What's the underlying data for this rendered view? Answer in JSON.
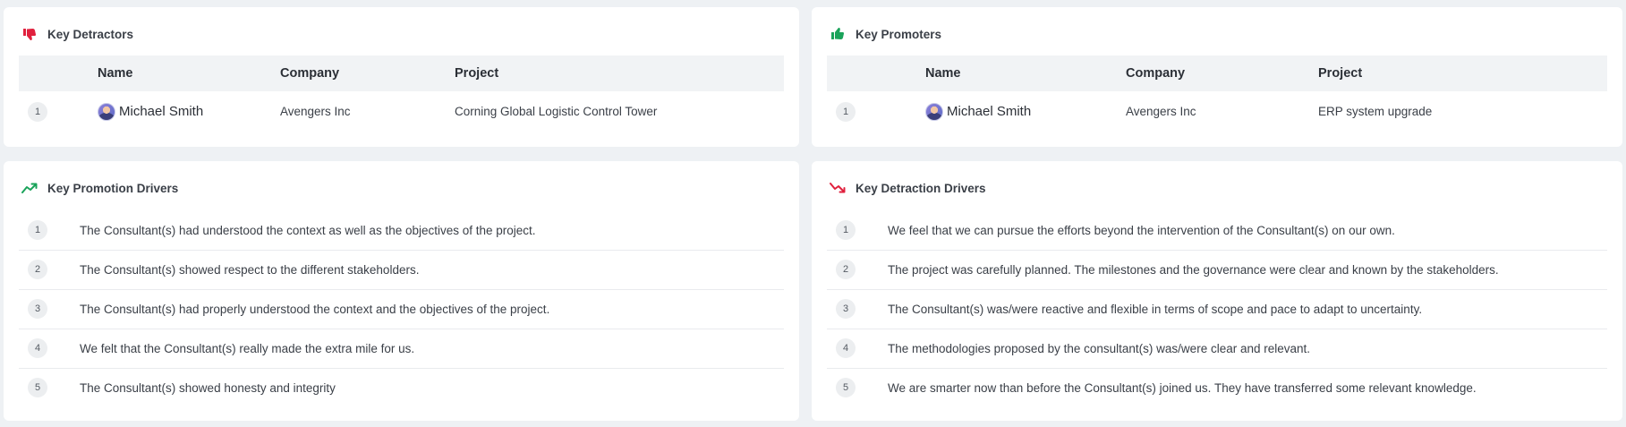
{
  "detractors": {
    "title": "Key Detractors",
    "icon": "thumbs-down-icon",
    "icon_color": "#e0203d",
    "columns": [
      "Name",
      "Company",
      "Project"
    ],
    "rows": [
      {
        "num": "1",
        "name": "Michael Smith",
        "company": "Avengers Inc",
        "project": "Corning Global Logistic Control Tower"
      }
    ]
  },
  "promoters": {
    "title": "Key Promoters",
    "icon": "thumbs-up-icon",
    "icon_color": "#1aa35a",
    "columns": [
      "Name",
      "Company",
      "Project"
    ],
    "rows": [
      {
        "num": "1",
        "name": "Michael Smith",
        "company": "Avengers Inc",
        "project": "ERP system upgrade"
      }
    ]
  },
  "promotion_drivers": {
    "title": "Key Promotion Drivers",
    "icon": "trend-up-icon",
    "icon_color": "#1aa35a",
    "items": [
      {
        "num": "1",
        "text": "The Consultant(s) had understood the context as well as the objectives of the project."
      },
      {
        "num": "2",
        "text": "The Consultant(s) showed respect to the different stakeholders."
      },
      {
        "num": "3",
        "text": "The Consultant(s) had properly understood the context and the objectives of the project."
      },
      {
        "num": "4",
        "text": "We felt that the Consultant(s) really made the extra mile for us."
      },
      {
        "num": "5",
        "text": "The Consultant(s) showed honesty and integrity"
      }
    ]
  },
  "detraction_drivers": {
    "title": "Key Detraction Drivers",
    "icon": "trend-down-icon",
    "icon_color": "#e0203d",
    "items": [
      {
        "num": "1",
        "text": "We feel that we can pursue the efforts beyond the intervention of the Consultant(s) on our own."
      },
      {
        "num": "2",
        "text": "The project was carefully planned. The milestones and the governance were clear and known by the stakeholders."
      },
      {
        "num": "3",
        "text": "The Consultant(s) was/were reactive and flexible in terms of scope and pace to adapt to uncertainty."
      },
      {
        "num": "4",
        "text": "The methodologies proposed by the consultant(s) was/were clear and relevant."
      },
      {
        "num": "5",
        "text": "We are smarter now than before the Consultant(s) joined us. They have transferred some relevant knowledge."
      }
    ]
  }
}
